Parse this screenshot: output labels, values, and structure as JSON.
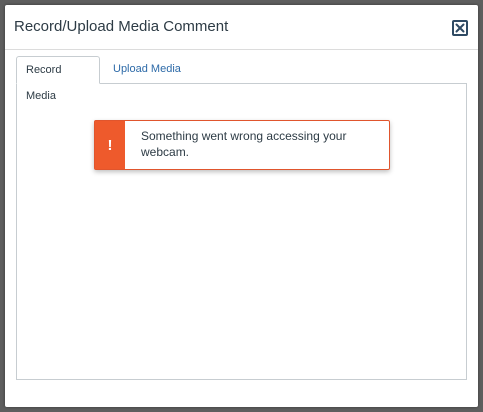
{
  "dialog": {
    "title": "Record/Upload Media Comment",
    "close_icon": "close-icon"
  },
  "tabs": [
    {
      "label": "Record Media",
      "active": true
    },
    {
      "label": "Upload Media",
      "active": false
    }
  ],
  "alert": {
    "icon": "exclamation-icon",
    "icon_glyph": "!",
    "message": "Something went wrong accessing your webcam.",
    "color": "#ee5a2c"
  }
}
